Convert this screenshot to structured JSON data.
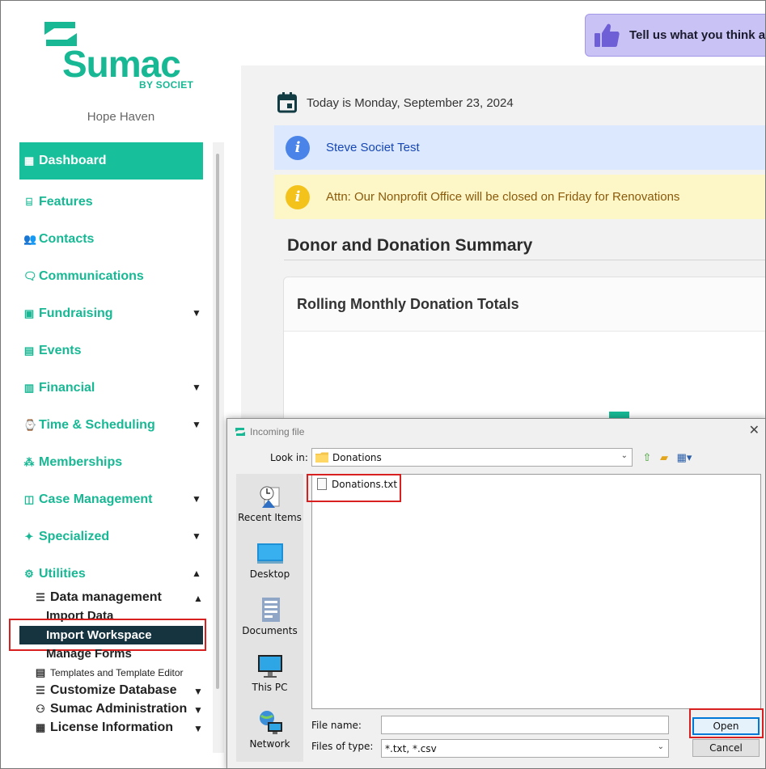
{
  "brand": {
    "name": "Sumac",
    "tagline": "BY SOCIET",
    "organization": "Hope Haven",
    "accent": "#18b894"
  },
  "feedback": {
    "text": "Tell us what you think a"
  },
  "sidebar": {
    "items": [
      {
        "label": "Dashboard",
        "icon": "dashboard-icon",
        "active": true
      },
      {
        "label": "Features",
        "icon": "gift-icon"
      },
      {
        "label": "Contacts",
        "icon": "people-icon"
      },
      {
        "label": "Communications",
        "icon": "chat-icon"
      },
      {
        "label": "Fundraising",
        "icon": "money-icon",
        "expandable": true
      },
      {
        "label": "Events",
        "icon": "calendar-icon"
      },
      {
        "label": "Financial",
        "icon": "bank-icon",
        "expandable": true
      },
      {
        "label": "Time & Scheduling",
        "icon": "clock-icon",
        "expandable": true
      },
      {
        "label": "Memberships",
        "icon": "group-icon"
      },
      {
        "label": "Case Management",
        "icon": "briefcase-icon",
        "expandable": true
      },
      {
        "label": "Specialized",
        "icon": "star-icon",
        "expandable": true
      },
      {
        "label": "Utilities",
        "icon": "cog-icon",
        "expanded": true
      }
    ],
    "utilities": {
      "data_management": "Data management",
      "import_data": "Import Data",
      "import_workspace": "Import Workspace",
      "manage_forms": "Manage Forms",
      "templates": "Templates and Template Editor",
      "customize_database": "Customize Database",
      "sumac_administration": "Sumac Administration",
      "license_information": "License Information"
    }
  },
  "main": {
    "today": "Today is Monday, September 23, 2024",
    "info_banner": "Steve Societ Test",
    "warning_banner": "Attn: Our Nonprofit Office will be closed on Friday for Renovations",
    "section_title": "Donor and Donation Summary",
    "card_title": "Rolling Monthly Donation Totals"
  },
  "dialog": {
    "title": "Incoming file",
    "look_in_label": "Look in:",
    "look_in_value": "Donations",
    "places": [
      {
        "label": "Recent Items",
        "icon": "recent-items-icon"
      },
      {
        "label": "Desktop",
        "icon": "desktop-icon"
      },
      {
        "label": "Documents",
        "icon": "documents-icon"
      },
      {
        "label": "This PC",
        "icon": "computer-icon"
      },
      {
        "label": "Network",
        "icon": "network-icon"
      }
    ],
    "files": [
      "Donations.txt"
    ],
    "file_name_label": "File name:",
    "file_name_value": "",
    "files_of_type_label": "Files of type:",
    "files_of_type_value": "*.txt, *.csv",
    "open_label": "Open",
    "cancel_label": "Cancel"
  }
}
